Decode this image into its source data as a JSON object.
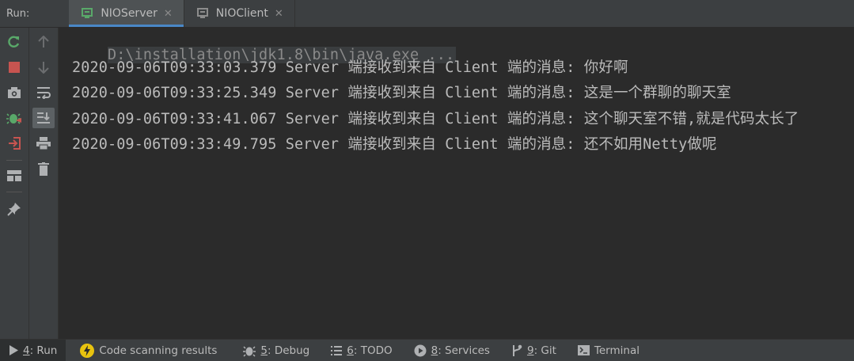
{
  "runbar": {
    "label": "Run:",
    "tabs": [
      {
        "label": "NIOServer",
        "close": "✕",
        "active": true
      },
      {
        "label": "NIOClient",
        "close": "✕",
        "active": false
      }
    ]
  },
  "left_toolbar": {
    "buttons": [
      "rerun-icon",
      "stop-icon",
      "camera-icon",
      "debug-bug-icon",
      "exit-icon",
      "layout-icon",
      "pin-icon"
    ]
  },
  "side_toolbar": {
    "buttons": [
      "up-arrow-icon",
      "down-arrow-icon",
      "soft-wrap-icon",
      "scroll-to-end-icon",
      "print-icon",
      "trash-icon"
    ]
  },
  "console": {
    "command": "D:\\installation\\jdk1.8\\bin\\java.exe ...",
    "lines": [
      "2020-09-06T09:33:03.379 Server 端接收到来自 Client 端的消息: 你好啊",
      "2020-09-06T09:33:25.349 Server 端接收到来自 Client 端的消息: 这是一个群聊的聊天室",
      "2020-09-06T09:33:41.067 Server 端接收到来自 Client 端的消息: 这个聊天室不错,就是代码太长了",
      "2020-09-06T09:33:49.795 Server 端接收到来自 Client 端的消息: 还不如用Netty做呢"
    ]
  },
  "bottombar": {
    "items": [
      {
        "num": "4",
        "label": ": Run",
        "icon": "run-icon"
      },
      {
        "num": "",
        "label": "Code scanning results",
        "icon": "lightning-icon"
      },
      {
        "num": "5",
        "label": ": Debug",
        "icon": "bug-icon"
      },
      {
        "num": "6",
        "label": ": TODO",
        "icon": "list-icon"
      },
      {
        "num": "8",
        "label": ": Services",
        "icon": "services-icon"
      },
      {
        "num": "9",
        "label": ": Git",
        "icon": "git-icon"
      },
      {
        "num": "",
        "label": "Terminal",
        "icon": "terminal-icon"
      }
    ]
  },
  "colors": {
    "accent": "#4a88c7",
    "green": "#59a869",
    "red": "#c75450",
    "yellow": "#e8c30f"
  }
}
